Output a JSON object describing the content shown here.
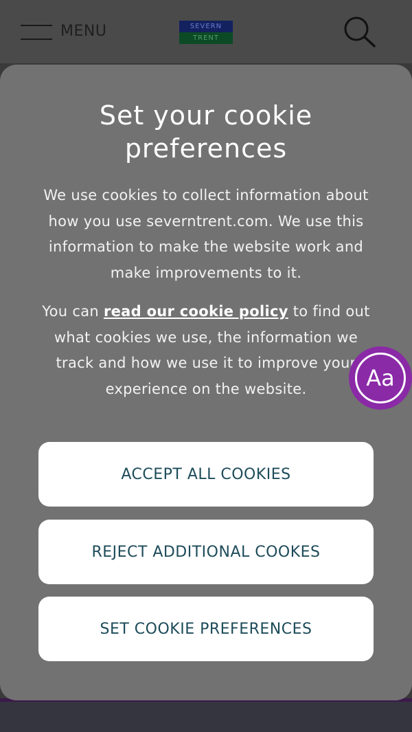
{
  "header": {
    "menu_label": "MENU",
    "logo": {
      "top_text": "SEVERN",
      "bottom_text": "TRENT"
    },
    "search_icon": "search-icon"
  },
  "modal": {
    "title": "Set your cookie preferences",
    "intro": "We use cookies to collect information about how you use severntrent.com. We use this information to make the website work and make improvements to it.",
    "policy_prefix": "You can ",
    "policy_link": "read our cookie policy",
    "policy_suffix": " to find out what cookies we use, the information we track and how we use it to improve your experience on the website.",
    "buttons": {
      "accept": "ACCEPT ALL COOKIES",
      "reject": "REJECT ADDITIONAL COOKES",
      "preferences": "SET COOKIE PREFERENCES"
    }
  },
  "accessibility_widget": {
    "label": "Aa"
  },
  "colors": {
    "overlay": "#727272",
    "button_text": "#1d4b5a",
    "widget_purple": "#8a2aa7",
    "logo_blue": "#14215f",
    "logo_green": "#0c4a25"
  }
}
